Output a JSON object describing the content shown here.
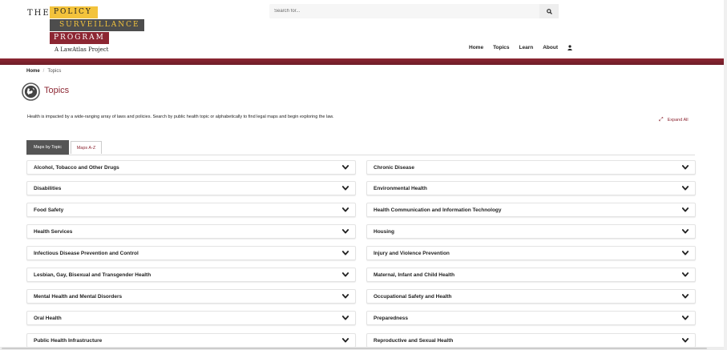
{
  "logo": {
    "the": "THE",
    "line1": "POLICY",
    "line2": "SURVEILLANCE",
    "line3": "PROGRAM",
    "subtitle": "A LawAtlas Project",
    "colors": {
      "yellow": "#f3c33c",
      "gray": "#4d4d4d",
      "maroon": "#8c2632"
    }
  },
  "search": {
    "placeholder": "Search for...",
    "icon": "search-icon"
  },
  "nav": {
    "home": "Home",
    "topics": "Topics",
    "learn": "Learn",
    "about": "About",
    "user_icon": "user-icon"
  },
  "breadcrumb": {
    "home": "Home",
    "separator": "/",
    "current": "Topics"
  },
  "page": {
    "title": "Topics",
    "intro": "Health is impacted by a wide-ranging array of laws and policies. Search by public health topic or alphabetically to find legal maps and begin exploring the law.",
    "expand_all": "Expand All",
    "accent_color": "#8c2632"
  },
  "tabs": [
    {
      "label": "Maps by Topic",
      "active": true
    },
    {
      "label": "Maps A-Z",
      "active": false
    }
  ],
  "topics_left": [
    "Alcohol, Tobacco and Other Drugs",
    "Disabilities",
    "Food Safety",
    "Health Services",
    "Infectious Disease Prevention and Control",
    "Lesbian, Gay, Bisexual and Transgender Health",
    "Mental Health and Mental Disorders",
    "Oral Health",
    "Public Health Infrastructure"
  ],
  "topics_right": [
    "Chronic Disease",
    "Environmental Health",
    "Health Communication and Information Technology",
    "Housing",
    "Injury and Violence Prevention",
    "Maternal, Infant and Child Health",
    "Occupational Safety and Health",
    "Preparedness",
    "Reproductive and Sexual Health"
  ]
}
